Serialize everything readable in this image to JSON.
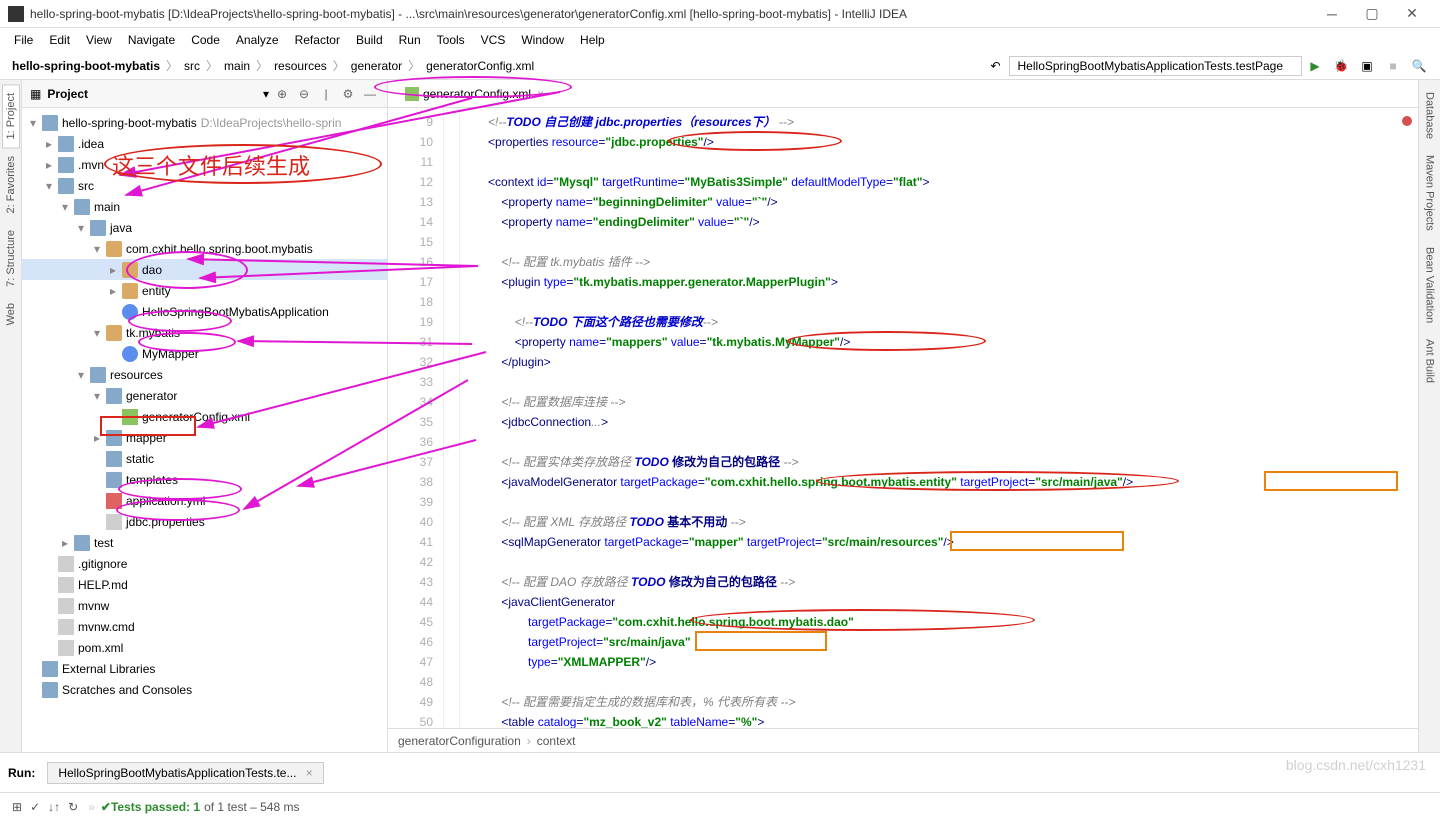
{
  "window": {
    "title": "hello-spring-boot-mybatis [D:\\IdeaProjects\\hello-spring-boot-mybatis] - ...\\src\\main\\resources\\generator\\generatorConfig.xml [hello-spring-boot-mybatis] - IntelliJ IDEA"
  },
  "menu": [
    "File",
    "Edit",
    "View",
    "Navigate",
    "Code",
    "Analyze",
    "Refactor",
    "Build",
    "Run",
    "Tools",
    "VCS",
    "Window",
    "Help"
  ],
  "breadcrumbs": [
    "hello-spring-boot-mybatis",
    "src",
    "main",
    "resources",
    "generator",
    "generatorConfig.xml"
  ],
  "runConfig": "HelloSpringBootMybatisApplicationTests.testPage",
  "projectPanel": {
    "title": "Project"
  },
  "leftTabs": [
    "1: Project",
    "2: Favorites",
    "7: Structure",
    "Web"
  ],
  "rightTabs": [
    "Database",
    "Maven Projects",
    "Bean Validation",
    "Ant Build"
  ],
  "tree": [
    {
      "d": 0,
      "a": "v",
      "i": "folder",
      "t": "hello-spring-boot-mybatis",
      "m": "D:\\IdeaProjects\\hello-sprin"
    },
    {
      "d": 1,
      "a": ">",
      "i": "folder",
      "t": ".idea"
    },
    {
      "d": 1,
      "a": ">",
      "i": "folder",
      "t": ".mvn"
    },
    {
      "d": 1,
      "a": "v",
      "i": "folder",
      "t": "src"
    },
    {
      "d": 2,
      "a": "v",
      "i": "folder",
      "t": "main"
    },
    {
      "d": 3,
      "a": "v",
      "i": "folder",
      "t": "java"
    },
    {
      "d": 4,
      "a": "v",
      "i": "pkg",
      "t": "com.cxhit.hello.spring.boot.mybatis"
    },
    {
      "d": 5,
      "a": ">",
      "i": "pkg",
      "t": "dao",
      "sel": true
    },
    {
      "d": 5,
      "a": ">",
      "i": "pkg",
      "t": "entity"
    },
    {
      "d": 5,
      "a": "",
      "i": "class",
      "t": "HelloSpringBootMybatisApplication"
    },
    {
      "d": 4,
      "a": "v",
      "i": "pkg",
      "t": "tk.mybatis"
    },
    {
      "d": 5,
      "a": "",
      "i": "class",
      "t": "MyMapper"
    },
    {
      "d": 3,
      "a": "v",
      "i": "folder",
      "t": "resources"
    },
    {
      "d": 4,
      "a": "v",
      "i": "folder",
      "t": "generator"
    },
    {
      "d": 5,
      "a": "",
      "i": "xml",
      "t": "generatorConfig.xml"
    },
    {
      "d": 4,
      "a": ">",
      "i": "folder",
      "t": "mapper"
    },
    {
      "d": 4,
      "a": "",
      "i": "folder",
      "t": "static"
    },
    {
      "d": 4,
      "a": "",
      "i": "folder",
      "t": "templates"
    },
    {
      "d": 4,
      "a": "",
      "i": "yml",
      "t": "application.yml"
    },
    {
      "d": 4,
      "a": "",
      "i": "file",
      "t": "jdbc.properties"
    },
    {
      "d": 2,
      "a": ">",
      "i": "folder",
      "t": "test"
    },
    {
      "d": 1,
      "a": "",
      "i": "file",
      "t": ".gitignore"
    },
    {
      "d": 1,
      "a": "",
      "i": "file",
      "t": "HELP.md"
    },
    {
      "d": 1,
      "a": "",
      "i": "file",
      "t": "mvnw"
    },
    {
      "d": 1,
      "a": "",
      "i": "file",
      "t": "mvnw.cmd"
    },
    {
      "d": 1,
      "a": "",
      "i": "file",
      "t": "pom.xml"
    },
    {
      "d": 0,
      "a": "",
      "i": "folder",
      "t": "External Libraries"
    },
    {
      "d": 0,
      "a": "",
      "i": "folder",
      "t": "Scratches and Consoles"
    }
  ],
  "editorTab": "generatorConfig.xml",
  "gutterStart": 9,
  "gutterSkips": {
    "20": 31,
    "21": 32
  },
  "code": [
    {
      "ind": 3,
      "seg": [
        [
          "cmt",
          "<!--"
        ],
        [
          "todo",
          "TODO 自己创建"
        ],
        [
          "todo",
          " jdbc.properties（resources下）"
        ],
        [
          "cmt",
          " -->"
        ]
      ]
    },
    {
      "ind": 3,
      "seg": [
        [
          "tag",
          "<properties "
        ],
        [
          "attr",
          "resource"
        ],
        [
          "tag",
          "="
        ],
        [
          "str",
          "\"jdbc.properties\""
        ],
        [
          "tag",
          "/>"
        ]
      ]
    },
    {
      "ind": 0,
      "seg": []
    },
    {
      "ind": 3,
      "seg": [
        [
          "tag",
          "<context "
        ],
        [
          "attr",
          "id"
        ],
        [
          "tag",
          "="
        ],
        [
          "str",
          "\"Mysql\""
        ],
        [
          "tag",
          " "
        ],
        [
          "attr",
          "targetRuntime"
        ],
        [
          "tag",
          "="
        ],
        [
          "str",
          "\"MyBatis3Simple\""
        ],
        [
          "tag",
          " "
        ],
        [
          "attr",
          "defaultModelType"
        ],
        [
          "tag",
          "="
        ],
        [
          "str",
          "\"flat\""
        ],
        [
          "tag",
          ">"
        ]
      ]
    },
    {
      "ind": 5,
      "seg": [
        [
          "tag",
          "<property "
        ],
        [
          "attr",
          "name"
        ],
        [
          "tag",
          "="
        ],
        [
          "str",
          "\"beginningDelimiter\""
        ],
        [
          "tag",
          " "
        ],
        [
          "attr",
          "value"
        ],
        [
          "tag",
          "="
        ],
        [
          "str",
          "\"`\""
        ],
        [
          "tag",
          "/>"
        ]
      ]
    },
    {
      "ind": 5,
      "seg": [
        [
          "tag",
          "<property "
        ],
        [
          "attr",
          "name"
        ],
        [
          "tag",
          "="
        ],
        [
          "str",
          "\"endingDelimiter\""
        ],
        [
          "tag",
          " "
        ],
        [
          "attr",
          "value"
        ],
        [
          "tag",
          "="
        ],
        [
          "str",
          "\"`\""
        ],
        [
          "tag",
          "/>"
        ]
      ]
    },
    {
      "ind": 0,
      "seg": []
    },
    {
      "ind": 5,
      "seg": [
        [
          "cmt",
          "<!-- 配置 tk.mybatis 插件 -->"
        ]
      ]
    },
    {
      "ind": 5,
      "seg": [
        [
          "tag",
          "<plugin "
        ],
        [
          "attr",
          "type"
        ],
        [
          "tag",
          "="
        ],
        [
          "str",
          "\"tk.mybatis.mapper.generator.MapperPlugin\""
        ],
        [
          "tag",
          ">"
        ]
      ]
    },
    {
      "ind": 0,
      "seg": []
    },
    {
      "ind": 7,
      "seg": [
        [
          "cmt",
          "<!--"
        ],
        [
          "todo",
          "TODO 下面这个路径也需要修改"
        ],
        [
          "cmt",
          "-->"
        ]
      ]
    },
    {
      "ind": 7,
      "seg": [
        [
          "tag",
          "<property "
        ],
        [
          "attr",
          "name"
        ],
        [
          "tag",
          "="
        ],
        [
          "str",
          "\"mappers\""
        ],
        [
          "tag",
          " "
        ],
        [
          "attr",
          "value"
        ],
        [
          "tag",
          "="
        ],
        [
          "str",
          "\"tk.mybatis.MyMapper\""
        ],
        [
          "tag",
          "/>"
        ]
      ]
    },
    {
      "ind": 5,
      "seg": [
        [
          "tag",
          "</plugin>"
        ]
      ]
    },
    {
      "ind": 0,
      "seg": []
    },
    {
      "ind": 5,
      "seg": [
        [
          "cmt",
          "<!-- 配置数据库连接 -->"
        ]
      ]
    },
    {
      "ind": 5,
      "seg": [
        [
          "tag",
          "<jdbcConnection"
        ],
        [
          "cmt",
          "..."
        ],
        [
          "tag",
          ">"
        ]
      ]
    },
    {
      "ind": 0,
      "seg": []
    },
    {
      "ind": 5,
      "seg": [
        [
          "cmt",
          "<!-- 配置实体类存放路径 "
        ],
        [
          "todo",
          "TODO"
        ],
        [
          "cn",
          " 修改为自己的包路径"
        ],
        [
          "cmt",
          " -->"
        ]
      ]
    },
    {
      "ind": 5,
      "seg": [
        [
          "tag",
          "<javaModelGenerator "
        ],
        [
          "attr",
          "targetPackage"
        ],
        [
          "tag",
          "="
        ],
        [
          "str",
          "\"com.cxhit.hello.spring.boot.mybatis.entity\""
        ],
        [
          "tag",
          " "
        ],
        [
          "attr",
          "targetProject"
        ],
        [
          "tag",
          "="
        ],
        [
          "str",
          "\"src/main/java\""
        ],
        [
          "tag",
          "/>"
        ]
      ]
    },
    {
      "ind": 0,
      "seg": []
    },
    {
      "ind": 5,
      "seg": [
        [
          "cmt",
          "<!-- 配置 XML 存放路径 "
        ],
        [
          "todo",
          "TODO"
        ],
        [
          "cn",
          " 基本不用动"
        ],
        [
          "cmt",
          " -->"
        ]
      ]
    },
    {
      "ind": 5,
      "seg": [
        [
          "tag",
          "<sqlMapGenerator "
        ],
        [
          "attr",
          "targetPackage"
        ],
        [
          "tag",
          "="
        ],
        [
          "str",
          "\"mapper\""
        ],
        [
          "tag",
          " "
        ],
        [
          "attr",
          "targetProject"
        ],
        [
          "tag",
          "="
        ],
        [
          "str",
          "\"src/main/resources\""
        ],
        [
          "tag",
          "/>"
        ]
      ]
    },
    {
      "ind": 0,
      "seg": []
    },
    {
      "ind": 5,
      "seg": [
        [
          "cmt",
          "<!-- 配置 DAO 存放路径 "
        ],
        [
          "todo",
          "TODO"
        ],
        [
          "cn",
          " 修改为自己的包路径"
        ],
        [
          "cmt",
          " -->"
        ]
      ]
    },
    {
      "ind": 5,
      "seg": [
        [
          "tag",
          "<javaClientGenerator"
        ]
      ]
    },
    {
      "ind": 9,
      "seg": [
        [
          "attr",
          "targetPackage"
        ],
        [
          "tag",
          "="
        ],
        [
          "str",
          "\"com.cxhit.hello.spring.boot.mybatis.dao\""
        ]
      ]
    },
    {
      "ind": 9,
      "seg": [
        [
          "attr",
          "targetProject"
        ],
        [
          "tag",
          "="
        ],
        [
          "str",
          "\"src/main/java\""
        ]
      ]
    },
    {
      "ind": 9,
      "seg": [
        [
          "attr",
          "type"
        ],
        [
          "tag",
          "="
        ],
        [
          "str",
          "\"XMLMAPPER\""
        ],
        [
          "tag",
          "/>"
        ]
      ]
    },
    {
      "ind": 0,
      "seg": []
    },
    {
      "ind": 5,
      "seg": [
        [
          "cmt",
          "<!-- 配置需要指定生成的数据库和表，% 代表所有表 -->"
        ]
      ]
    },
    {
      "ind": 5,
      "seg": [
        [
          "tag",
          "<table "
        ],
        [
          "attr",
          "catalog"
        ],
        [
          "tag",
          "="
        ],
        [
          "str",
          "\"mz_book_v2\""
        ],
        [
          "tag",
          " "
        ],
        [
          "attr",
          "tableName"
        ],
        [
          "tag",
          "="
        ],
        [
          "str",
          "\"%\""
        ],
        [
          "tag",
          ">"
        ]
      ]
    }
  ],
  "editorCrumb": [
    "generatorConfiguration",
    "context"
  ],
  "runPanel": {
    "label": "Run:",
    "tab": "HelloSpringBootMybatisApplicationTests.te..."
  },
  "statusBar": {
    "tests": "Tests passed: 1",
    "of": "of 1 test – 548 ms"
  },
  "annotationText": "这三个文件后续生成",
  "watermark": "blog.csdn.net/cxh1231"
}
